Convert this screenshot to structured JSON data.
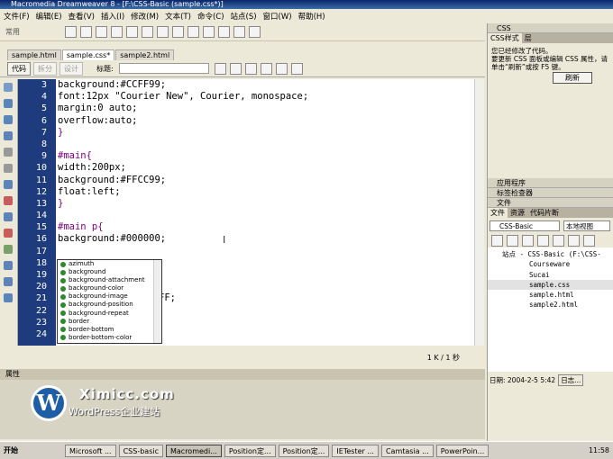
{
  "window": {
    "title": "Macromedia Dreamweaver 8 - [F:\\CSS-Basic (sample.css*)]"
  },
  "menu": [
    "文件(F)",
    "编辑(E)",
    "查看(V)",
    "插入(I)",
    "修改(M)",
    "文本(T)",
    "命令(C)",
    "站点(S)",
    "窗口(W)",
    "帮助(H)"
  ],
  "toolbar": {
    "category": "常用"
  },
  "doc_tabs": [
    "sample.html",
    "sample.css*",
    "sample2.html"
  ],
  "doc_toolbar": {
    "code": "代码",
    "split": "拆分",
    "design": "设计",
    "title_label": "标题:"
  },
  "editor": {
    "line_numbers": [
      "3",
      "4",
      "5",
      "6",
      "7",
      "8",
      "9",
      "10",
      "11",
      "12",
      "13",
      "14",
      "15",
      "16",
      "17",
      "18",
      "19",
      "20",
      "21",
      "22",
      "23",
      "24"
    ],
    "lines": [
      "background:#CCFF99;",
      "font:12px \"Courier New\", Courier, monospace;",
      "margin:0 auto;",
      "overflow:auto;",
      "}",
      "",
      "#main{",
      "width:200px;",
      "background:#FFCC99;",
      "float:left;",
      "}",
      "",
      "#main p{",
      "background:#000000;",
      "",
      "",
      "",
      "",
      "FF;",
      "",
      "",
      ""
    ],
    "status": "1 K / 1 秒"
  },
  "autocomplete": [
    "azimuth",
    "background",
    "background-attachment",
    "background-color",
    "background-image",
    "background-position",
    "background-repeat",
    "border",
    "border-bottom",
    "border-bottom-color"
  ],
  "properties_label": "属性",
  "watermark": {
    "brand": "Ximicc.com",
    "tagline": "WordPress企业建站"
  },
  "right_panel": {
    "css_header": "CSS",
    "css_tabs": [
      "CSS样式",
      "层"
    ],
    "css_message": "您已经修改了代码。\n要更新 CSS 面板或编辑 CSS 属性，请单击“刷新”或按 F5 键。",
    "refresh_button": "刷新",
    "sections": [
      "应用程序",
      "标签检查器",
      "文件"
    ],
    "file_tabs": [
      "文件",
      "资源",
      "代码片断"
    ],
    "site_select": "CSS-Basic",
    "view_select": "本地视图",
    "tree": [
      "站点 - CSS-Basic (F:\\CSS-",
      "Courseware",
      "Sucai",
      "sample.css",
      "sample.html",
      "sample2.html"
    ],
    "date_label": "日期: 2004-2-5 5:42",
    "log_button": "日志..."
  },
  "taskbar": {
    "start": "开始",
    "tasks": [
      "Microsoft ...",
      "CSS-basic",
      "Macromedi...",
      "Position定...",
      "Position定...",
      "IETester ...",
      "Camtasia ...",
      "PowerPoin..."
    ],
    "clock": "11:58"
  }
}
